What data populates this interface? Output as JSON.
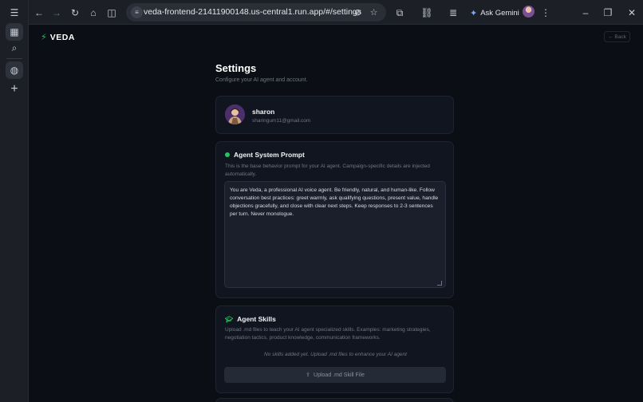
{
  "browser": {
    "url": "veda-frontend-21411900148.us-central1.run.app/#/settings",
    "ask_gemini_label": "Ask Gemini"
  },
  "app": {
    "brand": "VEDA",
    "back_label": "← Back",
    "accent_color": "#22c55e"
  },
  "page": {
    "title": "Settings",
    "subtitle": "Configure your AI agent and account."
  },
  "profile": {
    "name": "sharon",
    "email": "sharingum11@gmail.com"
  },
  "system_prompt": {
    "title": "Agent System Prompt",
    "description": "This is the base behavior prompt for your AI agent. Campaign-specific details are injected automatically.",
    "value": "You are Veda, a professional AI voice agent. Be friendly, natural, and human-like. Follow conversation best practices: greet warmly, ask qualifying questions, present value, handle objections gracefully, and close with clear next steps. Keep responses to 2-3 sentences per turn. Never monologue."
  },
  "skills": {
    "title": "Agent Skills",
    "description": "Upload .md files to teach your AI agent specialized skills. Examples: marketing strategies, negotiation tactics, product knowledge, communication frameworks.",
    "empty_text": "No skills added yet. Upload .md files to enhance your AI agent",
    "upload_label": "Upload .md Skill File"
  }
}
